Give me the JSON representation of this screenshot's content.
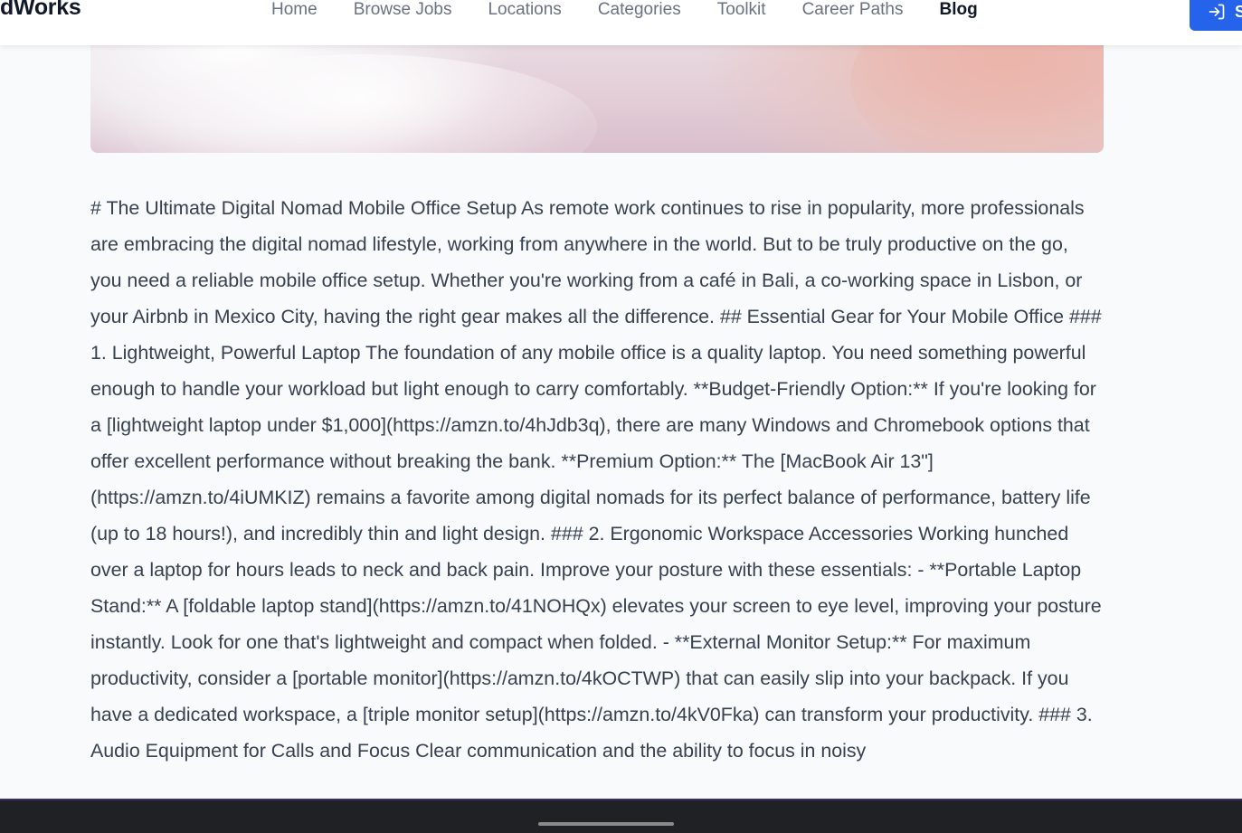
{
  "header": {
    "brand": "dWorks",
    "nav": [
      {
        "label": "Home",
        "active": false
      },
      {
        "label": "Browse Jobs",
        "active": false
      },
      {
        "label": "Locations",
        "active": false
      },
      {
        "label": "Categories",
        "active": false
      },
      {
        "label": "Toolkit",
        "active": false
      },
      {
        "label": "Career Paths",
        "active": false
      },
      {
        "label": "Blog",
        "active": true
      }
    ],
    "signin_label": "S"
  },
  "article": {
    "body": "# The Ultimate Digital Nomad Mobile Office Setup As remote work continues to rise in popularity, more professionals are embracing the digital nomad lifestyle, working from anywhere in the world. But to be truly productive on the go, you need a reliable mobile office setup. Whether you're working from a café in Bali, a co-working space in Lisbon, or your Airbnb in Mexico City, having the right gear makes all the difference. ## Essential Gear for Your Mobile Office ### 1. Lightweight, Powerful Laptop The foundation of any mobile office is a quality laptop. You need something powerful enough to handle your workload but light enough to carry comfortably. **Budget-Friendly Option:** If you're looking for a [lightweight laptop under $1,000](https://amzn.to/4hJdb3q), there are many Windows and Chromebook options that offer excellent performance without breaking the bank. **Premium Option:** The [MacBook Air 13\"](https://amzn.to/4iUMKIZ) remains a favorite among digital nomads for its perfect balance of performance, battery life (up to 18 hours!), and incredibly thin and light design. ### 2. Ergonomic Workspace Accessories Working hunched over a laptop for hours leads to neck and back pain. Improve your posture with these essentials: - **Portable Laptop Stand:** A [foldable laptop stand](https://amzn.to/41NOHQx) elevates your screen to eye level, improving your posture instantly. Look for one that's lightweight and compact when folded. - **External Monitor Setup:** For maximum productivity, consider a [portable monitor](https://amzn.to/4kOCTWP) that can easily slip into your backpack. If you have a dedicated workspace, a [triple monitor setup](https://amzn.to/4kV0Fka) can transform your productivity. ### 3. Audio Equipment for Calls and Focus Clear communication and the ability to focus in noisy"
  },
  "colors": {
    "accent": "#2563eb",
    "nav_text": "#6b7280",
    "body_text": "#374151",
    "background": "#f9fafb"
  }
}
